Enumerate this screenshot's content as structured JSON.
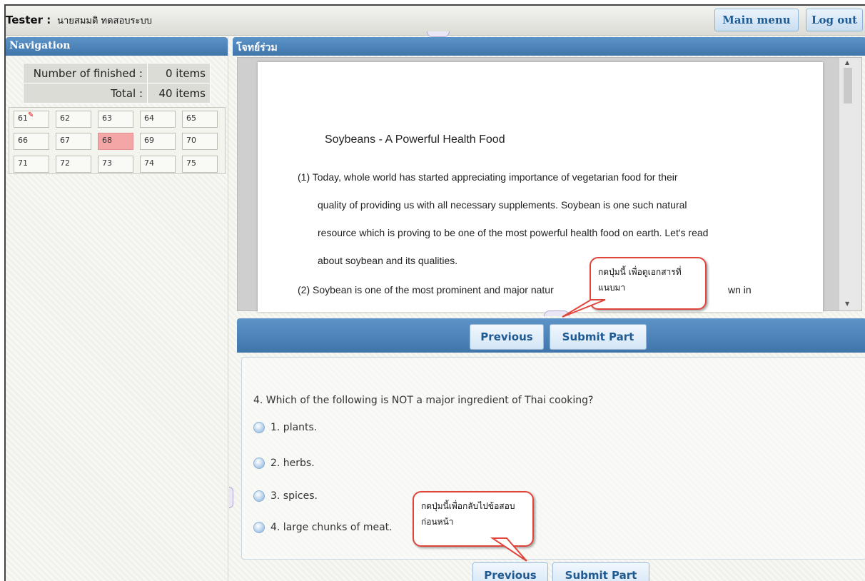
{
  "topbar": {
    "tester_label": "Tester :",
    "tester_name": "นายสมมติ ทดสอบระบบ",
    "main_menu_label": "Main menu",
    "logout_label": "Log out"
  },
  "navigation": {
    "title": "Navigation",
    "finished_label": "Number of finished :",
    "finished_value": "0 items",
    "total_label": "Total :",
    "total_value": "40 items",
    "questions": [
      "61",
      "62",
      "63",
      "64",
      "65",
      "66",
      "67",
      "68",
      "69",
      "70",
      "71",
      "72",
      "73",
      "74",
      "75"
    ],
    "flagged": "61",
    "current": "68"
  },
  "document": {
    "header": "โจทย์ร่วม",
    "title": "Soybeans - A Powerful Health Food",
    "para1_lines": [
      "(1) Today, whole world has started appreciating importance of vegetarian food for their",
      "quality of providing us with all necessary supplements. Soybean is one such natural",
      "resource which is proving to be one of the most powerful health food on earth. Let's read",
      "about soybean and its qualities."
    ],
    "para2_start": "(2) Soybean is one of the most prominent and major natur",
    "para2_end": "wn in"
  },
  "buttons": {
    "previous": "Previous",
    "submit_part": "Submit Part"
  },
  "question": {
    "text": "4.  Which of the following is NOT a major ingredient of Thai cooking?",
    "options": [
      "1.  plants.",
      "2.  herbs.",
      "3.  spices.",
      "4.  large chunks of meat."
    ]
  },
  "callouts": {
    "doc_tip": [
      "กดปุ่มนี้ เพื่อดูเอกสารที่",
      "แนบมา"
    ],
    "prev_tip": [
      "กดปุ่มนี้เพื่อกลับไปข้อสอบ",
      "ก่อนหน้า"
    ],
    "tip_color": "#e0453c"
  },
  "colors": {
    "header_blue": "#4a80b6",
    "button_text": "#1f5a93",
    "current_question": "#f4a6a6"
  }
}
